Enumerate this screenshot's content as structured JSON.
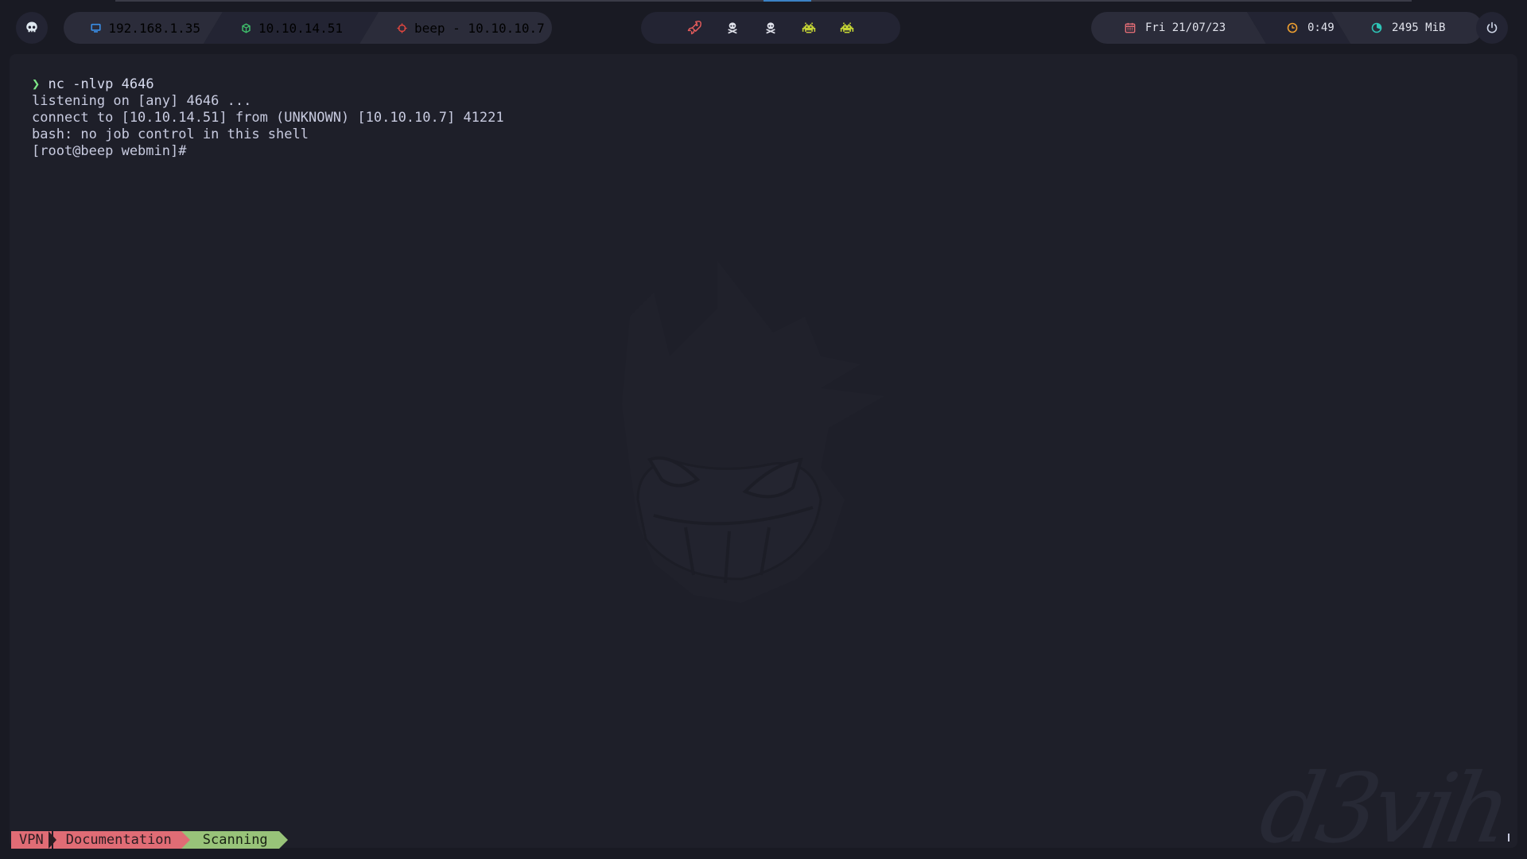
{
  "topbar": {
    "logo_icon": "skull-icon",
    "network": {
      "local_ip": "192.168.1.35",
      "vpn_ip": "10.10.14.51",
      "target": "beep - 10.10.10.7"
    },
    "workspaces": [
      {
        "icon": "rocket-icon",
        "color": "#e05a5a"
      },
      {
        "icon": "skull-crossbones-icon",
        "color": "#e1e3ec"
      },
      {
        "icon": "skull-crossbones-icon",
        "color": "#e1e3ec"
      },
      {
        "icon": "space-invader-icon",
        "color": "#c4d435"
      },
      {
        "icon": "space-invader-icon",
        "color": "#c4d435"
      }
    ],
    "date": "Fri 21/07/23",
    "time": "0:49",
    "memory": "2495 MiB",
    "power_icon": "power-icon"
  },
  "terminal": {
    "prompt_symbol": "❯",
    "command": "nc -nlvp 4646",
    "output": [
      "listening on [any] 4646 ...",
      "connect to [10.10.14.51] from (UNKNOWN) [10.10.10.7] 41221",
      "bash: no job control in this shell",
      "[root@beep webmin]#"
    ],
    "signature": "d3vjh"
  },
  "statusbar": {
    "tabs": [
      "VPN",
      "Documentation",
      "Scanning"
    ]
  },
  "colors": {
    "background": "#191a23",
    "terminal_bg": "#1e1f29",
    "pill": "#232433",
    "accent_red": "#e06c75",
    "accent_green": "#98c379",
    "vpn_green": "#3fbf6b",
    "target_red": "#e0463f",
    "local_blue": "#3a8ee6"
  }
}
